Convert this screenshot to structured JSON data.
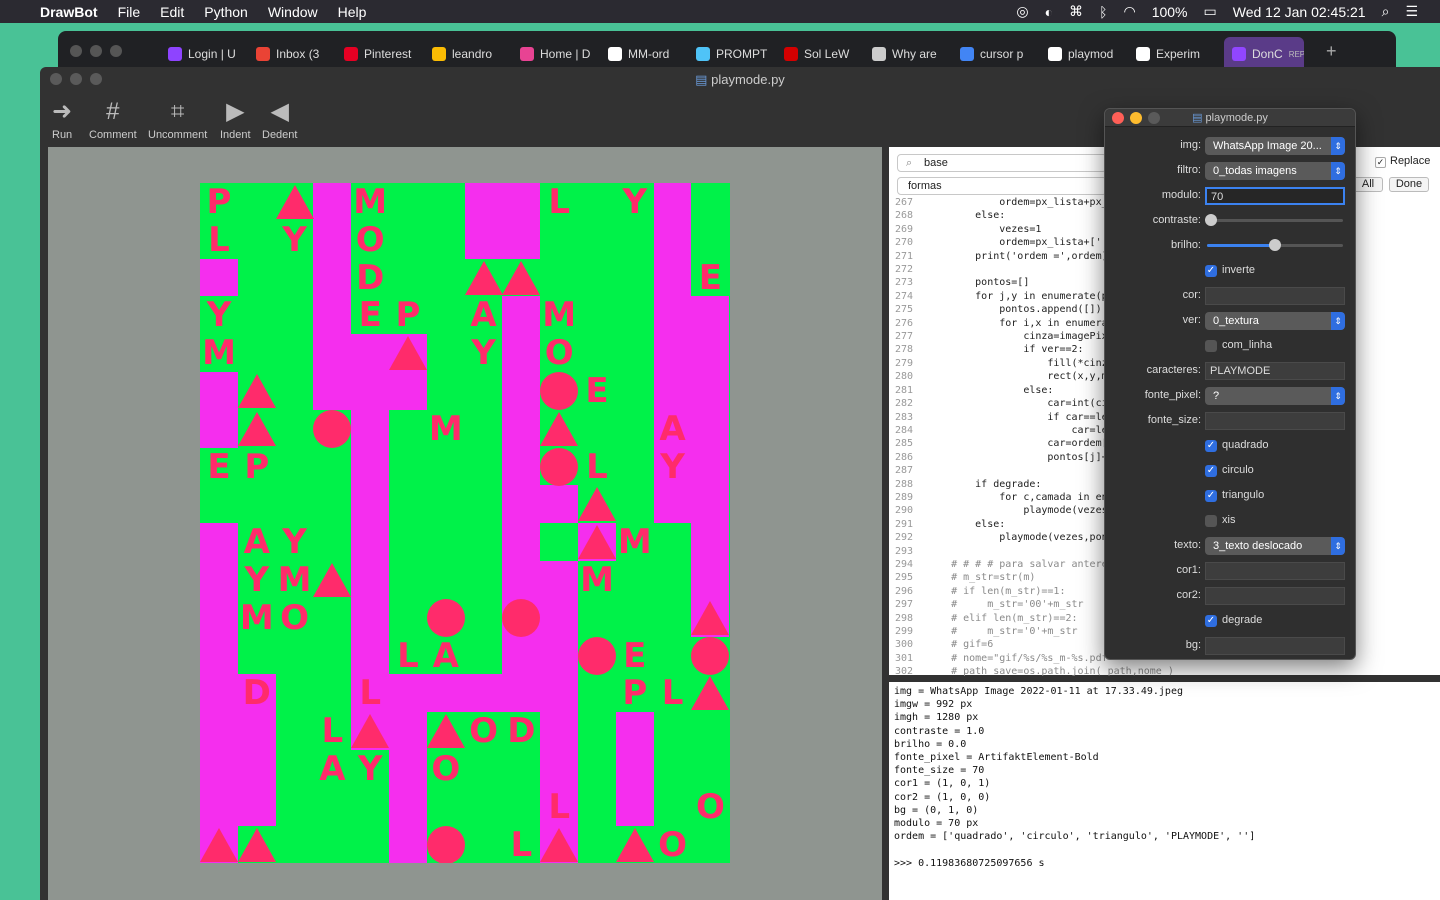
{
  "menubar": {
    "app": "DrawBot",
    "items": [
      "File",
      "Edit",
      "Python",
      "Window",
      "Help"
    ],
    "battery": "100%",
    "clock": "Wed 12 Jan  02:45:21"
  },
  "browser_tabs": [
    {
      "label": "Login | U",
      "color": "#8e44ff"
    },
    {
      "label": "Inbox (3",
      "color": "#ea4335"
    },
    {
      "label": "Pinterest",
      "color": "#e60023"
    },
    {
      "label": "leandro",
      "color": "#fbbc04"
    },
    {
      "label": "Home | D",
      "color": "#e84393"
    },
    {
      "label": "MM-ord",
      "color": "#ffffff"
    },
    {
      "label": "PROMPT",
      "color": "#4fc3f7"
    },
    {
      "label": "Sol LeW",
      "color": "#d50000"
    },
    {
      "label": "Why are",
      "color": "#cccccc"
    },
    {
      "label": "cursor p",
      "color": "#4285f4"
    },
    {
      "label": "playmod",
      "color": "#ffffff"
    },
    {
      "label": "Experim",
      "color": "#ffffff"
    },
    {
      "label": "DonC",
      "sub": "REPRO",
      "color": "#9146ff"
    }
  ],
  "window": {
    "title": "playmode.py",
    "toolbar": [
      {
        "label": "Run",
        "icon": "➜"
      },
      {
        "label": "Comment",
        "icon": "#"
      },
      {
        "label": "Uncomment",
        "icon": "⌗"
      },
      {
        "label": "Indent",
        "icon": "▶"
      },
      {
        "label": "Dedent",
        "icon": "◀"
      }
    ]
  },
  "search": {
    "find_value": "base",
    "replace_value": "formas",
    "replace_label": "Replace",
    "all_label": "All",
    "done_label": "Done"
  },
  "code": [
    {
      "n": "267",
      "t": "            ordem=px_lista+px_"
    },
    {
      "n": "268",
      "t": "        else:"
    },
    {
      "n": "269",
      "t": "            vezes=1"
    },
    {
      "n": "270",
      "t": "            ordem=px_lista+[''"
    },
    {
      "n": "271",
      "t": "        print('ordem =',ordem)"
    },
    {
      "n": "272",
      "t": ""
    },
    {
      "n": "273",
      "t": "        pontos=[]"
    },
    {
      "n": "274",
      "t": "        for j,y in enumerate(po"
    },
    {
      "n": "275",
      "t": "            pontos.append([])"
    },
    {
      "n": "276",
      "t": "            for i,x in enumerat"
    },
    {
      "n": "277",
      "t": "                cinza=imagePix"
    },
    {
      "n": "278",
      "t": "                if ver==2:"
    },
    {
      "n": "279",
      "t": "                    fill(*cinz"
    },
    {
      "n": "280",
      "t": "                    rect(x,y,m"
    },
    {
      "n": "281",
      "t": "                else:"
    },
    {
      "n": "282",
      "t": "                    car=int(ci"
    },
    {
      "n": "283",
      "t": "                    if car==le"
    },
    {
      "n": "284",
      "t": "                        car=le"
    },
    {
      "n": "285",
      "t": "                    car=ordem["
    },
    {
      "n": "286",
      "t": "                    pontos[j]+"
    },
    {
      "n": "287",
      "t": ""
    },
    {
      "n": "288",
      "t": "        if degrade:"
    },
    {
      "n": "289",
      "t": "            for c,camada in en"
    },
    {
      "n": "290",
      "t": "                playmode(vezes"
    },
    {
      "n": "291",
      "t": "        else:"
    },
    {
      "n": "292",
      "t": "            playmode(vezes,pont"
    },
    {
      "n": "293",
      "t": ""
    },
    {
      "n": "294",
      "t": "    # # # # para salvar antere"
    },
    {
      "n": "295",
      "t": "    # m_str=str(m)"
    },
    {
      "n": "296",
      "t": "    # if len(m_str)==1:"
    },
    {
      "n": "297",
      "t": "    #     m_str='00'+m_str"
    },
    {
      "n": "298",
      "t": "    # elif len(m_str)==2:"
    },
    {
      "n": "299",
      "t": "    #     m_str='0'+m_str"
    },
    {
      "n": "300",
      "t": "    # gif=6"
    },
    {
      "n": "301",
      "t": "    # nome=\"gif/%s/%s_m-%s.pdf"
    },
    {
      "n": "302",
      "t": "    # path_save=os.path.join( path,nome )"
    }
  ],
  "console": [
    "img = WhatsApp Image 2022-01-11 at 17.33.49.jpeg",
    "imgw = 992 px",
    "imgh = 1280 px",
    "contraste = 1.0",
    "brilho = 0.0",
    "fonte_pixel = ArtifaktElement-Bold",
    "fonte_size = 70",
    "cor1 = (1, 0, 1)",
    "cor2 = (1, 0, 0)",
    "bg = (0, 1, 0)",
    "modulo = 70 px",
    "ordem = ['quadrado', 'circulo', 'triangulo', 'PLAYMODE', '']",
    "",
    ">>> 0.11983680725097656 s"
  ],
  "panel": {
    "title": "playmode.py",
    "img": {
      "label": "img:",
      "value": "WhatsApp Image 20..."
    },
    "filtro": {
      "label": "filtro:",
      "value": "0_todas imagens"
    },
    "modulo": {
      "label": "modulo:",
      "value": "70"
    },
    "contraste": {
      "label": "contraste:",
      "value": 0.0
    },
    "brilho": {
      "label": "brilho:",
      "value": 0.5
    },
    "inverte": {
      "label": "inverte",
      "checked": true
    },
    "cor": {
      "label": "cor:",
      "value": ""
    },
    "ver": {
      "label": "ver:",
      "value": "0_textura"
    },
    "com_linha": {
      "label": "com_linha",
      "checked": false
    },
    "caracteres": {
      "label": "caracteres:",
      "value": "PLAYMODE"
    },
    "fonte_pixel": {
      "label": "fonte_pixel:",
      "value": "?"
    },
    "fonte_size": {
      "label": "fonte_size:",
      "value": ""
    },
    "quadrado": {
      "label": "quadrado",
      "checked": true
    },
    "circulo": {
      "label": "circulo",
      "checked": true
    },
    "triangulo": {
      "label": "triangulo",
      "checked": true
    },
    "xis": {
      "label": "xis",
      "checked": false
    },
    "texto": {
      "label": "texto:",
      "value": "3_texto deslocado"
    },
    "cor1": {
      "label": "cor1:",
      "value": ""
    },
    "cor2": {
      "label": "cor2:",
      "value": ""
    },
    "degrade": {
      "label": "degrade",
      "checked": true
    },
    "bg": {
      "label": "bg:",
      "value": ""
    }
  },
  "artwork": {
    "colors": {
      "bg": "#00f249",
      "block": "#f52eee",
      "mark": "#ff2b6b"
    },
    "letters": [
      [
        "P",
        0,
        0
      ],
      [
        "M",
        4,
        0
      ],
      [
        "L",
        9,
        0
      ],
      [
        "Y",
        11,
        0
      ],
      [
        "L",
        0,
        1
      ],
      [
        "Y",
        2,
        1
      ],
      [
        "O",
        4,
        1
      ],
      [
        "D",
        4,
        2
      ],
      [
        "E",
        13,
        2
      ],
      [
        "Y",
        0,
        3
      ],
      [
        "E",
        4,
        3
      ],
      [
        "P",
        5,
        3
      ],
      [
        "A",
        7,
        3
      ],
      [
        "M",
        9,
        3
      ],
      [
        "M",
        0,
        4
      ],
      [
        "Y",
        7,
        4
      ],
      [
        "O",
        9,
        4
      ],
      [
        "E",
        10,
        5
      ],
      [
        "M",
        6,
        6
      ],
      [
        "A",
        12,
        6
      ],
      [
        "E",
        0,
        7
      ],
      [
        "P",
        1,
        7
      ],
      [
        "L",
        10,
        7
      ],
      [
        "Y",
        12,
        7
      ],
      [
        "A",
        1,
        9
      ],
      [
        "Y",
        2,
        9
      ],
      [
        "M",
        11,
        9
      ],
      [
        "Y",
        1,
        10
      ],
      [
        "M",
        2,
        10
      ],
      [
        "M",
        10,
        10
      ],
      [
        "M",
        1,
        11
      ],
      [
        "O",
        2,
        11
      ],
      [
        "L",
        5,
        12
      ],
      [
        "A",
        6,
        12
      ],
      [
        "E",
        11,
        12
      ],
      [
        "D",
        1,
        13
      ],
      [
        "L",
        4,
        13
      ],
      [
        "P",
        11,
        13
      ],
      [
        "L",
        12,
        13
      ],
      [
        "L",
        3,
        14
      ],
      [
        "O",
        7,
        14
      ],
      [
        "D",
        8,
        14
      ],
      [
        "A",
        3,
        15
      ],
      [
        "Y",
        4,
        15
      ],
      [
        "O",
        6,
        15
      ],
      [
        "L",
        9,
        16
      ],
      [
        "O",
        13,
        16
      ],
      [
        "L",
        8,
        17
      ],
      [
        "O",
        12,
        17
      ]
    ],
    "circles": [
      [
        3,
        6
      ],
      [
        9,
        5
      ],
      [
        9,
        7
      ],
      [
        6,
        11
      ],
      [
        8,
        11
      ],
      [
        10,
        12
      ],
      [
        13,
        12
      ],
      [
        6,
        17
      ]
    ],
    "triangles": [
      [
        2,
        0
      ],
      [
        7,
        2
      ],
      [
        8,
        2
      ],
      [
        5,
        4
      ],
      [
        1,
        5
      ],
      [
        1,
        6
      ],
      [
        9,
        6
      ],
      [
        10,
        8
      ],
      [
        10,
        9
      ],
      [
        3,
        10
      ],
      [
        13,
        11
      ],
      [
        13,
        13
      ],
      [
        4,
        14
      ],
      [
        6,
        14
      ],
      [
        0,
        17
      ],
      [
        1,
        17
      ],
      [
        9,
        17
      ],
      [
        11,
        17
      ]
    ],
    "blocks": [
      [
        0,
        2,
        1,
        1
      ],
      [
        3,
        0,
        1,
        6
      ],
      [
        3,
        5,
        3,
        1
      ],
      [
        4,
        4,
        1,
        1
      ],
      [
        4,
        5,
        1,
        10
      ],
      [
        5,
        4,
        1,
        1
      ],
      [
        7,
        0,
        2,
        2
      ],
      [
        8,
        3,
        1,
        10
      ],
      [
        9,
        8,
        1,
        1
      ],
      [
        8,
        10,
        2,
        1
      ],
      [
        9,
        10,
        1,
        8
      ],
      [
        10,
        9,
        1,
        1
      ],
      [
        12,
        0,
        1,
        9
      ],
      [
        13,
        3,
        1,
        9
      ],
      [
        0,
        5,
        1,
        2
      ],
      [
        0,
        9,
        1,
        9
      ],
      [
        1,
        13,
        1,
        4
      ],
      [
        5,
        13,
        1,
        5
      ],
      [
        6,
        13,
        3,
        1
      ],
      [
        11,
        14,
        1,
        3
      ]
    ]
  }
}
